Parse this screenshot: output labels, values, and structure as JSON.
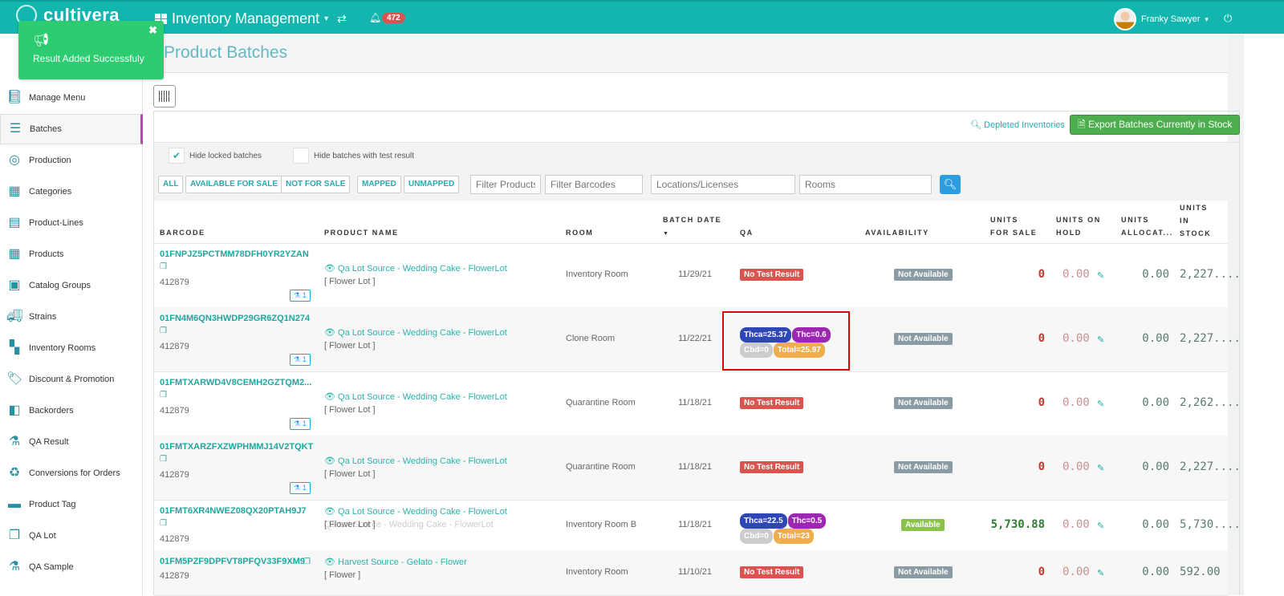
{
  "header": {
    "brand": "cultivera",
    "app": "Inventory Management",
    "notifications": "472",
    "user": "Franky Sawyer"
  },
  "toast": {
    "message": "Result Added Successfuly"
  },
  "sidebar": {
    "items": [
      {
        "label": "Manage Menu",
        "icon": "book-icon"
      },
      {
        "label": "Batches",
        "icon": "list-icon"
      },
      {
        "label": "Production",
        "icon": "target-icon"
      },
      {
        "label": "Categories",
        "icon": "table-icon"
      },
      {
        "label": "Product-Lines",
        "icon": "columns-icon"
      },
      {
        "label": "Products",
        "icon": "grid-icon"
      },
      {
        "label": "Catalog Groups",
        "icon": "catalog-icon"
      },
      {
        "label": "Strains",
        "icon": "truck-icon"
      },
      {
        "label": "Inventory Rooms",
        "icon": "rooms-icon"
      },
      {
        "label": "Discount & Promotion",
        "icon": "tag-icon"
      },
      {
        "label": "Backorders",
        "icon": "backorder-icon"
      },
      {
        "label": "QA Result",
        "icon": "flask-icon"
      },
      {
        "label": "Conversions for Orders",
        "icon": "recycle-icon"
      },
      {
        "label": "Product Tag",
        "icon": "label-icon"
      },
      {
        "label": "QA Lot",
        "icon": "copy-icon"
      },
      {
        "label": "QA Sample",
        "icon": "flask-icon"
      }
    ]
  },
  "page": {
    "title": "Product Batches",
    "depleted": "Depleted Inventories",
    "export": "Export Batches Currently in Stock"
  },
  "filters": {
    "hide_locked": "Hide locked batches",
    "hide_tested": "Hide batches with test result",
    "buttons": [
      "ALL",
      "AVAILABLE FOR SALE",
      "NOT FOR SALE",
      "MAPPED",
      "UNMAPPED"
    ],
    "products_ph": "Filter Products",
    "barcodes_ph": "Filter Barcodes",
    "locations_ph": "Locations/Licenses",
    "rooms_ph": "Rooms"
  },
  "columns": {
    "barcode": "BARCODE",
    "product": "PRODUCT NAME",
    "room": "ROOM",
    "date": "BATCH DATE",
    "qa": "QA",
    "availability": "AVAILABILITY",
    "for_sale": "UNITS FOR SALE",
    "on_hold": "UNITS ON HOLD",
    "allocated": "UNITS ALLOCAT...",
    "in_stock": "UNITS IN STOCK"
  },
  "rows": [
    {
      "barcode": "01FNPJZ5PCTMM78DFH0YR2YZAN",
      "code": "412879",
      "qa_count": "1",
      "product": "Qa Lot Source - Wedding Cake - FlowerLot",
      "sub": "",
      "type": "[ Flower Lot ]",
      "room": "Inventory Room",
      "date": "11/29/21",
      "qa": "No Test Result",
      "availability": "Not Available",
      "for_sale": "0",
      "on_hold": "0.00",
      "allocated": "0.00",
      "in_stock": "2,227...."
    },
    {
      "barcode": "01FN4M6QN3HWDP29GR6ZQ1N274",
      "code": "412879",
      "qa_count": "1",
      "product": "Qa Lot Source - Wedding Cake - FlowerLot",
      "sub": "",
      "type": "[ Flower Lot ]",
      "room": "Clone Room",
      "date": "11/22/21",
      "qa_results": {
        "thca": "Thca=25.37",
        "thc": "Thc=0.6",
        "cbd": "Cbd=0",
        "total": "Total=25.97"
      },
      "availability": "Not Available",
      "for_sale": "0",
      "on_hold": "0.00",
      "allocated": "0.00",
      "in_stock": "2,227...."
    },
    {
      "barcode": "01FMTXARWD4V8CEMH2GZTQM2...",
      "code": "412879",
      "qa_count": "1",
      "product": "Qa Lot Source - Wedding Cake - FlowerLot",
      "sub": "",
      "type": "[ Flower Lot ]",
      "room": "Quarantine Room",
      "date": "11/18/21",
      "qa": "No Test Result",
      "availability": "Not Available",
      "for_sale": "0",
      "on_hold": "0.00",
      "allocated": "0.00",
      "in_stock": "2,262...."
    },
    {
      "barcode": "01FMTXARZFXZWPHMMJ14V2TQKT",
      "code": "412879",
      "qa_count": "1",
      "product": "Qa Lot Source - Wedding Cake - FlowerLot",
      "sub": "",
      "type": "[ Flower Lot ]",
      "room": "Quarantine Room",
      "date": "11/18/21",
      "qa": "No Test Result",
      "availability": "Not Available",
      "for_sale": "0",
      "on_hold": "0.00",
      "allocated": "0.00",
      "in_stock": "2,227...."
    },
    {
      "barcode": "01FMT6XR4NWEZ08QX20PTAH9J7",
      "code": "412879",
      "product": "Qa Lot Source - Wedding Cake - FlowerLot",
      "sub": "Qa Lot Source - Wedding Cake - FlowerLot",
      "type": "[ Flower Lot ]",
      "room": "Inventory Room B",
      "date": "11/18/21",
      "qa_results": {
        "thca": "Thca=22.5",
        "thc": "Thc=0.5",
        "cbd": "Cbd=0",
        "total": "Total=23"
      },
      "availability": "Available",
      "for_sale": "5,730.88",
      "on_hold": "0.00",
      "allocated": "0.00",
      "in_stock": "5,730...."
    },
    {
      "barcode": "01FM5PZF9DPFVT8PFQV33F9XM9",
      "code": "412879",
      "product": "Harvest Source - Gelato - Flower",
      "sub": "",
      "type": "[ Flower ]",
      "room": "Inventory Room",
      "date": "11/10/21",
      "qa": "No Test Result",
      "availability": "Not Available",
      "for_sale": "0",
      "on_hold": "0.00",
      "allocated": "0.00",
      "in_stock": "592.00"
    }
  ],
  "colors": {
    "teal": "#13b6ae",
    "red": "#d9534f",
    "gray": "#8a9ba3",
    "green": "#8bc34a",
    "thca": "#2f47b5",
    "thc": "#9c27b0",
    "cbd": "#cccccc",
    "total": "#f0ad4e"
  }
}
